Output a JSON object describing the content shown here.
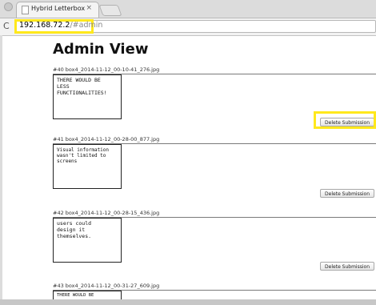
{
  "browser": {
    "tab_title": "Hybrid Letterbox",
    "tab_close": "×",
    "reload_symbol": "C",
    "url_host": "192.168.72.2",
    "url_path": "/#admin"
  },
  "page": {
    "title": "Admin View",
    "delete_label": "Delete Submission",
    "submissions": [
      {
        "caption": "#40 box4_2014-11-12_00-10-41_276.jpg",
        "note": "THERE WOULD BE\nLESS\nFUNCTIONALITIES!"
      },
      {
        "caption": "#41 box4_2014-11-12_00-28-00_877.jpg",
        "note": "Visual information\nwasn't limited to\nscreens"
      },
      {
        "caption": "#42 box4_2014-11-12_00-28-15_436.jpg",
        "note": "users could\ndesign it\nthemselves."
      },
      {
        "caption": "#43 box4_2014-11-12_00-31-27_609.jpg",
        "note": "THERE WOULD BE"
      }
    ]
  }
}
